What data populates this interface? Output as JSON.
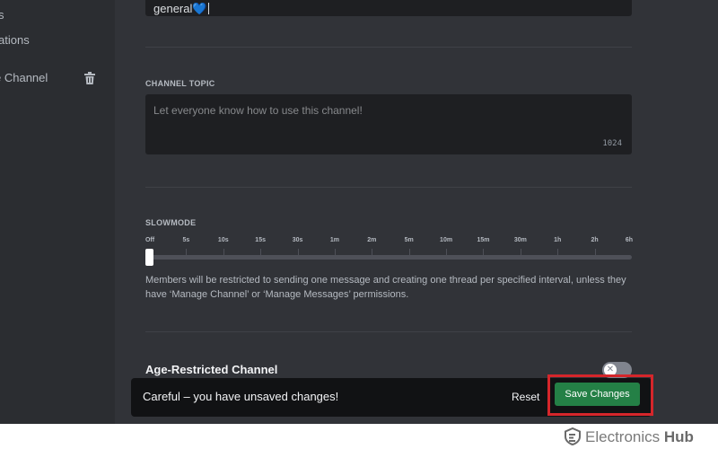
{
  "sidebar": {
    "items": [
      {
        "label": "s"
      },
      {
        "label": "ations"
      },
      {
        "label": "e Channel"
      }
    ]
  },
  "channel_name": {
    "value": "general",
    "emoji": "💙"
  },
  "channel_topic": {
    "label": "CHANNEL TOPIC",
    "placeholder": "Let everyone know how to use this channel!",
    "remaining": "1024"
  },
  "slowmode": {
    "label": "SLOWMODE",
    "ticks": [
      "Off",
      "5s",
      "10s",
      "15s",
      "30s",
      "1m",
      "2m",
      "5m",
      "10m",
      "15m",
      "30m",
      "1h",
      "2h",
      "6h"
    ],
    "selected_index": 0,
    "description": "Members will be restricted to sending one message and creating one thread per specified interval, unless they have ‘Manage Channel’ or ‘Manage Messages’ permissions."
  },
  "age_restricted": {
    "label": "Age-Restricted Channel",
    "enabled": false,
    "knob_glyph": "✕"
  },
  "unsaved_notice": {
    "text": "Careful – you have unsaved changes!",
    "reset_label": "Reset",
    "save_label": "Save Changes"
  },
  "watermark": {
    "name": "Electronics",
    "bold": "Hub"
  },
  "colors": {
    "background": "#313338",
    "sidebar": "#2b2d31",
    "save": "#248046",
    "highlight": "#d5262b"
  }
}
